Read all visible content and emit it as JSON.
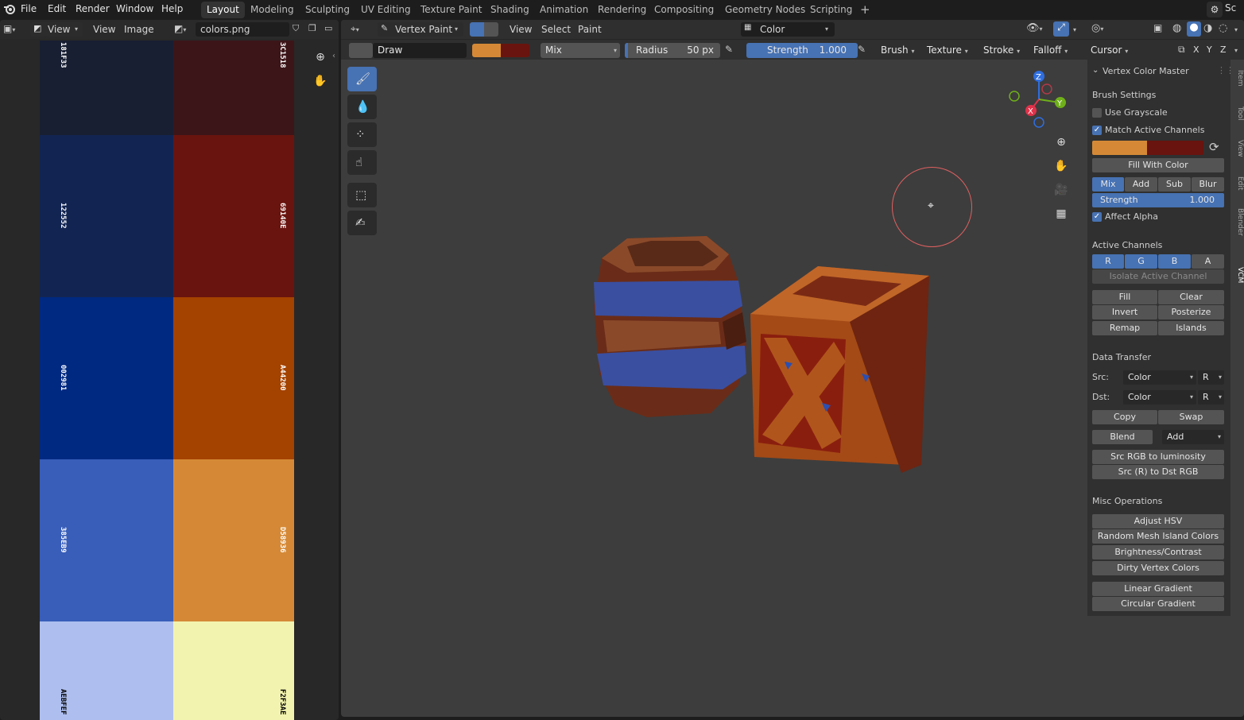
{
  "menu": {
    "items": [
      "File",
      "Edit",
      "Render",
      "Window",
      "Help"
    ],
    "workspaces": [
      "Layout",
      "Modeling",
      "Sculpting",
      "UV Editing",
      "Texture Paint",
      "Shading",
      "Animation",
      "Rendering",
      "Compositing",
      "Geometry Nodes",
      "Scripting"
    ],
    "active_workspace": "Layout",
    "add_tab": "+",
    "scene_label": "Sc"
  },
  "image_editor": {
    "view_menu": "View",
    "view_menu2": "View",
    "image_menu": "Image",
    "image_name": "colors.png",
    "swatches": [
      {
        "hex": "#181F33",
        "label": "181F33",
        "text_color": "#ffffff"
      },
      {
        "hex": "#3C1518",
        "label": "3C1518",
        "text_color": "#ffffff"
      },
      {
        "hex": "#122552",
        "label": "122552",
        "text_color": "#ffffff"
      },
      {
        "hex": "#69140E",
        "label": "69140E",
        "text_color": "#ffffff"
      },
      {
        "hex": "#002981",
        "label": "002981",
        "text_color": "#ffffff"
      },
      {
        "hex": "#A44200",
        "label": "A44200",
        "text_color": "#ffffff"
      },
      {
        "hex": "#385EB9",
        "label": "385EB9",
        "text_color": "#ffffff"
      },
      {
        "hex": "#D58936",
        "label": "D58936",
        "text_color": "#ffffff"
      },
      {
        "hex": "#AEBFEF",
        "label": "AEBFEF",
        "text_color": "#000000"
      },
      {
        "hex": "#F2F3AE",
        "label": "F2F3AE",
        "text_color": "#000000"
      }
    ]
  },
  "viewport": {
    "mode": "Vertex Paint",
    "menus": [
      "View",
      "Select",
      "Paint"
    ],
    "color_mode": "Color",
    "brush_name": "Draw",
    "primary_color": "#D58936",
    "secondary_color": "#69140E",
    "blend": "Mix",
    "radius_label": "Radius",
    "radius_value": "50 px",
    "strength_label": "Strength",
    "strength_value": "1.000",
    "popovers": [
      "Brush",
      "Texture",
      "Stroke",
      "Falloff",
      "Cursor"
    ],
    "axes": [
      "X",
      "Y",
      "Z"
    ],
    "gizmo_labels": {
      "z": "Z",
      "y": "Y",
      "x": "X"
    }
  },
  "panel": {
    "title": "Vertex Color Master",
    "brush_settings": "Brush Settings",
    "use_grayscale": "Use Grayscale",
    "match_active_channels": "Match Active Channels",
    "fill_with_color": "Fill With Color",
    "blend_modes": [
      "Mix",
      "Add",
      "Sub",
      "Blur"
    ],
    "strength_label": "Strength",
    "strength_value": "1.000",
    "affect_alpha": "Affect Alpha",
    "active_channels": "Active Channels",
    "channels": [
      "R",
      "G",
      "B",
      "A"
    ],
    "active_channel_states": [
      true,
      true,
      true,
      false
    ],
    "isolate_active_channel": "Isolate Active Channel",
    "ops": [
      [
        "Fill",
        "Clear"
      ],
      [
        "Invert",
        "Posterize"
      ],
      [
        "Remap",
        "Islands"
      ]
    ],
    "data_transfer": "Data Transfer",
    "src_label": "Src:",
    "dst_label": "Dst:",
    "src_value": "Color",
    "dst_value": "Color",
    "src_channel": "R",
    "dst_channel": "R",
    "copy": "Copy",
    "swap": "Swap",
    "blend": "Blend",
    "blend_mode": "Add",
    "src_rgb_to_luminosity": "Src RGB to luminosity",
    "src_r_to_dst_rgb": "Src (R) to Dst RGB",
    "misc_operations": "Misc Operations",
    "misc": [
      "Adjust HSV",
      "Random Mesh Island Colors",
      "Brightness/Contrast",
      "Dirty Vertex Colors"
    ],
    "gradients": [
      "Linear Gradient",
      "Circular Gradient"
    ]
  },
  "side_tabs": [
    "Item",
    "Tool",
    "View",
    "Edit",
    "Blender",
    "VCM"
  ]
}
